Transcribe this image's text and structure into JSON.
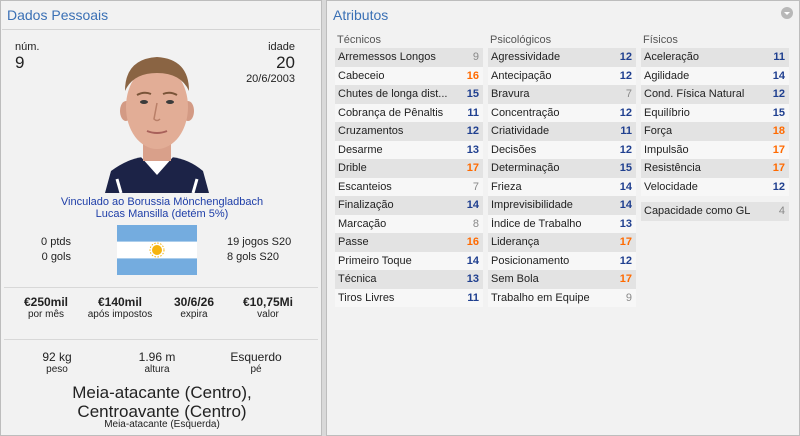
{
  "personal": {
    "title": "Dados Pessoais",
    "num_label": "núm.",
    "num_value": "9",
    "age_label": "idade",
    "age_value": "20",
    "birthdate": "20/6/2003",
    "club_line": "Vinculado ao Borussia Mönchengladbach",
    "agent_line": "Lucas Mansilla (detém 5%)",
    "pts": "0 ptds",
    "goals": "0 gols",
    "u20_games": "19 jogos S20",
    "u20_goals": "8 gols S20",
    "flag_icon": "argentina-flag-icon",
    "finance": [
      {
        "value": "€250mil",
        "label": "por mês"
      },
      {
        "value": "€140mil",
        "label": "após impostos"
      },
      {
        "value": "30/6/26",
        "label": "expira"
      },
      {
        "value": "€10,75Mi",
        "label": "valor"
      }
    ],
    "physical": [
      {
        "value": "92 kg",
        "label": "peso"
      },
      {
        "value": "1.96 m",
        "label": "altura"
      },
      {
        "value": "Esquerdo",
        "label": "pé"
      }
    ],
    "positions_line1": "Meia-atacante (Centro),",
    "positions_line2": "Centroavante (Centro)",
    "position_secondary": "Meia-atacante (Esquerda)"
  },
  "attributes": {
    "title": "Atributos",
    "menu_icon": "dropdown-chevron-icon",
    "colors": {
      "low": "#888888",
      "mid": "#1f3f8f",
      "high": "#ff6a00"
    },
    "technical": {
      "heading": "Técnicos",
      "items": [
        {
          "name": "Arremessos Longos",
          "value": "9"
        },
        {
          "name": "Cabeceio",
          "value": "16"
        },
        {
          "name": "Chutes de longa dist...",
          "value": "15"
        },
        {
          "name": "Cobrança de Pênaltis",
          "value": "11"
        },
        {
          "name": "Cruzamentos",
          "value": "12"
        },
        {
          "name": "Desarme",
          "value": "13"
        },
        {
          "name": "Drible",
          "value": "17"
        },
        {
          "name": "Escanteios",
          "value": "7"
        },
        {
          "name": "Finalização",
          "value": "14"
        },
        {
          "name": "Marcação",
          "value": "8"
        },
        {
          "name": "Passe",
          "value": "16"
        },
        {
          "name": "Primeiro Toque",
          "value": "14"
        },
        {
          "name": "Técnica",
          "value": "13"
        },
        {
          "name": "Tiros Livres",
          "value": "11"
        }
      ]
    },
    "mental": {
      "heading": "Psicológicos",
      "items": [
        {
          "name": "Agressividade",
          "value": "12"
        },
        {
          "name": "Antecipação",
          "value": "12"
        },
        {
          "name": "Bravura",
          "value": "7"
        },
        {
          "name": "Concentração",
          "value": "12"
        },
        {
          "name": "Criatividade",
          "value": "11"
        },
        {
          "name": "Decisões",
          "value": "12"
        },
        {
          "name": "Determinação",
          "value": "15"
        },
        {
          "name": "Frieza",
          "value": "14"
        },
        {
          "name": "Imprevisibilidade",
          "value": "14"
        },
        {
          "name": "Índice de Trabalho",
          "value": "13"
        },
        {
          "name": "Liderança",
          "value": "17"
        },
        {
          "name": "Posicionamento",
          "value": "12"
        },
        {
          "name": "Sem Bola",
          "value": "17"
        },
        {
          "name": "Trabalho em Equipe",
          "value": "9"
        }
      ]
    },
    "physical": {
      "heading": "Físicos",
      "items": [
        {
          "name": "Aceleração",
          "value": "11"
        },
        {
          "name": "Agilidade",
          "value": "14"
        },
        {
          "name": "Cond. Física Natural",
          "value": "12"
        },
        {
          "name": "Equilíbrio",
          "value": "15"
        },
        {
          "name": "Força",
          "value": "18"
        },
        {
          "name": "Impulsão",
          "value": "17"
        },
        {
          "name": "Resistência",
          "value": "17"
        },
        {
          "name": "Velocidade",
          "value": "12"
        }
      ]
    },
    "gk": {
      "name": "Capacidade como GL",
      "value": "4"
    }
  }
}
